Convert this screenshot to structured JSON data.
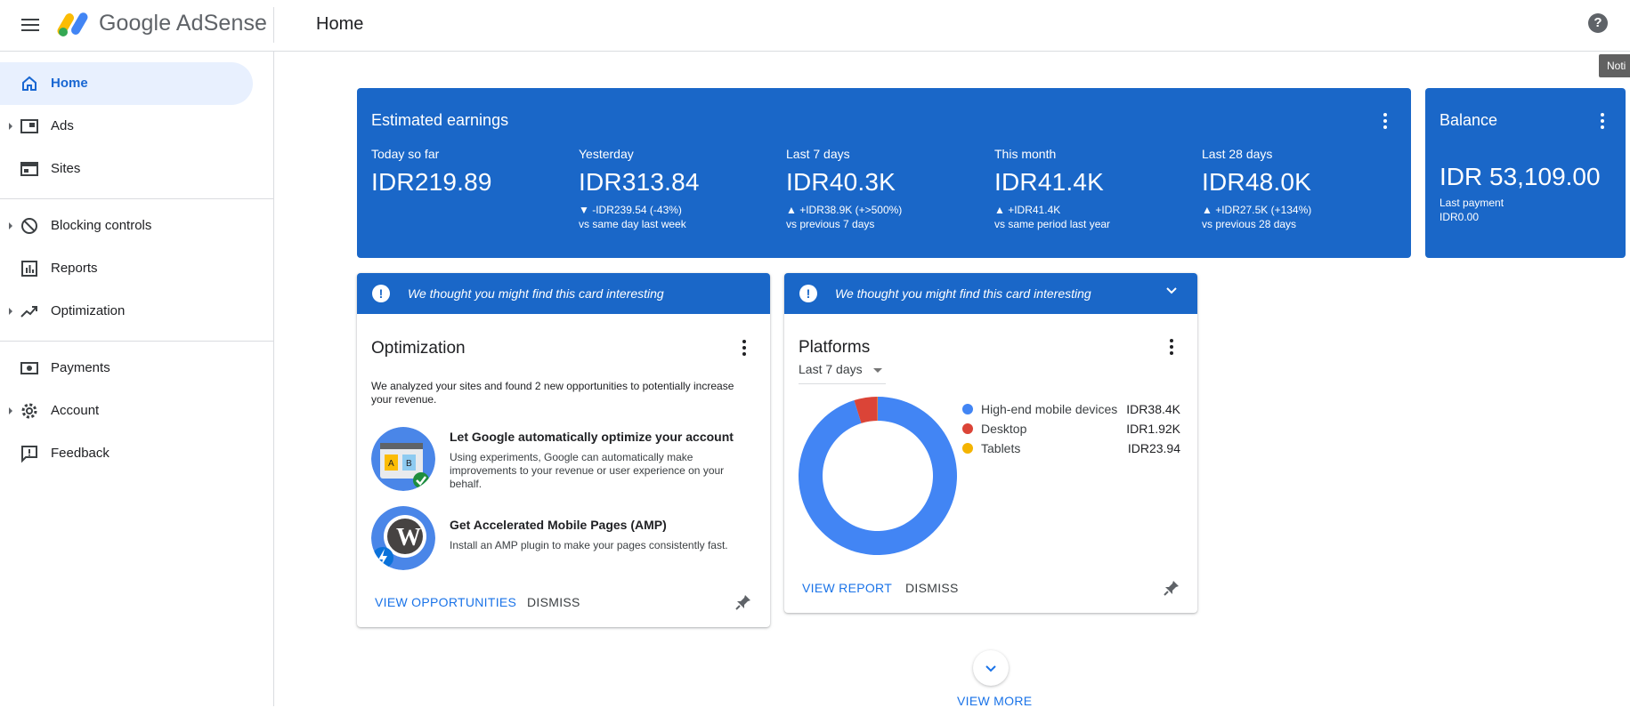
{
  "app": {
    "brand": "Google AdSense",
    "page_title": "Home",
    "help_icon": "help-icon",
    "tooltip": "Noti"
  },
  "sidebar": {
    "items": [
      {
        "label": "Home",
        "icon": "home-icon",
        "active": true,
        "expandable": false
      },
      {
        "label": "Ads",
        "icon": "ads-icon",
        "active": false,
        "expandable": true
      },
      {
        "label": "Sites",
        "icon": "sites-icon",
        "active": false,
        "expandable": false
      },
      {
        "label": "Blocking controls",
        "icon": "block-icon",
        "active": false,
        "expandable": true
      },
      {
        "label": "Reports",
        "icon": "reports-icon",
        "active": false,
        "expandable": false
      },
      {
        "label": "Optimization",
        "icon": "trending-up-icon",
        "active": false,
        "expandable": true
      },
      {
        "label": "Payments",
        "icon": "payments-icon",
        "active": false,
        "expandable": false
      },
      {
        "label": "Account",
        "icon": "gear-icon",
        "active": false,
        "expandable": true
      },
      {
        "label": "Feedback",
        "icon": "feedback-icon",
        "active": false,
        "expandable": false
      }
    ]
  },
  "earnings": {
    "title": "Estimated earnings",
    "metrics": [
      {
        "label": "Today so far",
        "value": "IDR219.89",
        "change": "",
        "compare": ""
      },
      {
        "label": "Yesterday",
        "value": "IDR313.84",
        "change": "▼ -IDR239.54 (-43%)",
        "compare": "vs same day last week"
      },
      {
        "label": "Last 7 days",
        "value": "IDR40.3K",
        "change": "▲ +IDR38.9K (+>500%)",
        "compare": "vs previous 7 days"
      },
      {
        "label": "This month",
        "value": "IDR41.4K",
        "change": "▲ +IDR41.4K",
        "compare": "vs same period last year"
      },
      {
        "label": "Last 28 days",
        "value": "IDR48.0K",
        "change": "▲ +IDR27.5K (+134%)",
        "compare": "vs previous 28 days"
      }
    ]
  },
  "balance": {
    "title": "Balance",
    "amount": "IDR 53,109.00",
    "last_payment_label": "Last payment",
    "last_payment_value": "IDR0.00"
  },
  "optimization_card": {
    "banner": "We thought you might find this card interesting",
    "title": "Optimization",
    "intro": "We analyzed your sites and found 2 new opportunities to potentially increase your revenue.",
    "opportunities": [
      {
        "title": "Let Google automatically optimize your account",
        "desc": "Using experiments, Google can automatically make improvements to your revenue or user experience on your behalf."
      },
      {
        "title": "Get Accelerated Mobile Pages (AMP)",
        "desc": "Install an AMP plugin to make your pages consistently fast."
      }
    ],
    "primary_action": "VIEW OPPORTUNITIES",
    "secondary_action": "DISMISS"
  },
  "platforms_card": {
    "banner": "We thought you might find this card interesting",
    "title": "Platforms",
    "range": "Last 7 days",
    "legend": [
      {
        "name": "High-end mobile devices",
        "value": "IDR38.4K",
        "color": "#4285f4"
      },
      {
        "name": "Desktop",
        "value": "IDR1.92K",
        "color": "#db4437"
      },
      {
        "name": "Tablets",
        "value": "IDR23.94",
        "color": "#f4b400"
      }
    ],
    "primary_action": "VIEW REPORT",
    "secondary_action": "DISMISS"
  },
  "view_more": "VIEW MORE",
  "chart_data": {
    "type": "pie",
    "categories": [
      "High-end mobile devices",
      "Desktop",
      "Tablets"
    ],
    "values": [
      38400,
      1920,
      23.94
    ],
    "colors": [
      "#4285f4",
      "#db4437",
      "#f4b400"
    ],
    "donut": true
  }
}
